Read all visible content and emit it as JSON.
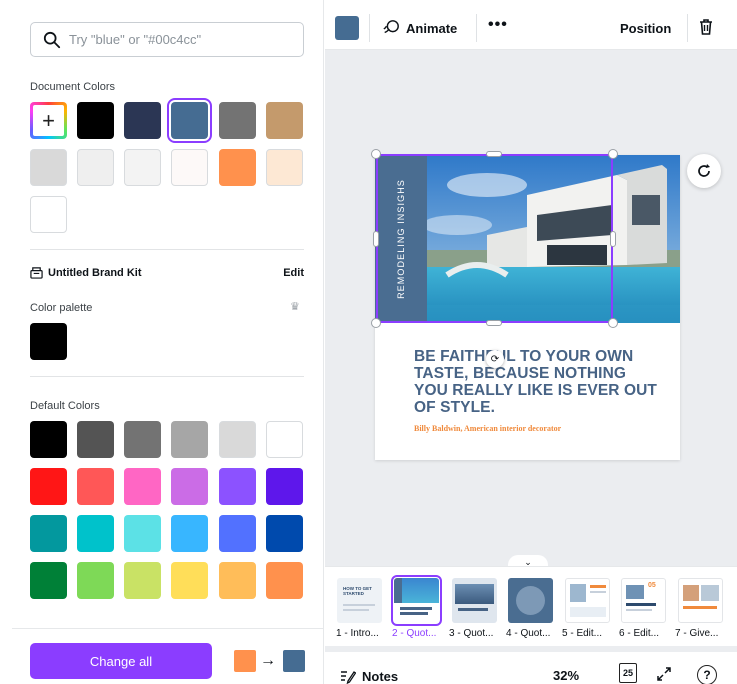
{
  "search": {
    "placeholder": "Try \"blue\" or \"#00c4cc\""
  },
  "document_colors": {
    "title": "Document Colors",
    "swatches": [
      "#000000",
      "#2b3654",
      "#456c92",
      "#737373",
      "#c49a6c",
      "#d9d9d9",
      "#efefef",
      "#f3f3f3",
      "#fdf9f8",
      "#ff914d",
      "#fde8d4",
      "#ffffff"
    ],
    "selected": "#456c92",
    "add_label": "+"
  },
  "brand_kit": {
    "name": "Untitled Brand Kit",
    "edit_label": "Edit",
    "palette_title": "Color palette",
    "palette": [
      "#000000"
    ]
  },
  "default_colors": {
    "title": "Default Colors",
    "swatches": [
      "#000000",
      "#545454",
      "#737373",
      "#a6a6a6",
      "#d9d9d9",
      "#ffffff",
      "#ff1616",
      "#ff5757",
      "#ff66c4",
      "#cb6ce6",
      "#8c52ff",
      "#5e17eb",
      "#03989e",
      "#00c2cb",
      "#5ce1e6",
      "#38b6ff",
      "#5271ff",
      "#004aad",
      "#008037",
      "#7ed957",
      "#c9e265",
      "#ffde59",
      "#ffbd59",
      "#ff914d"
    ]
  },
  "change_all": {
    "label": "Change all",
    "from_color": "#ff914d",
    "to_color": "#456c92",
    "arrow": "→"
  },
  "toolbar": {
    "color": "#456c92",
    "animate": "Animate",
    "more": "•••",
    "position": "Position"
  },
  "design": {
    "vertical_text": "REMODELING INSIGHS",
    "quote": "BE FAITHFUL TO YOUR OWN TASTE, BECAUSE NOTHING YOU REALLY LIKE IS EVER OUT OF STYLE.",
    "author": "Billy Baldwin, American interior decorator"
  },
  "pages": [
    {
      "label": "1 - Intro...",
      "selected": false
    },
    {
      "label": "2 - Quot...",
      "selected": true
    },
    {
      "label": "3 - Quot...",
      "selected": false
    },
    {
      "label": "4 - Quot...",
      "selected": false
    },
    {
      "label": "5 - Edit...",
      "selected": false
    },
    {
      "label": "6 - Edit...",
      "selected": false
    },
    {
      "label": "7 - Give...",
      "selected": false
    }
  ],
  "thumb_text": {
    "t1": "HOW TO GET STARTED",
    "t6": "05"
  },
  "footer": {
    "notes": "Notes",
    "zoom": "32%",
    "page_count": "25",
    "help": "?"
  }
}
